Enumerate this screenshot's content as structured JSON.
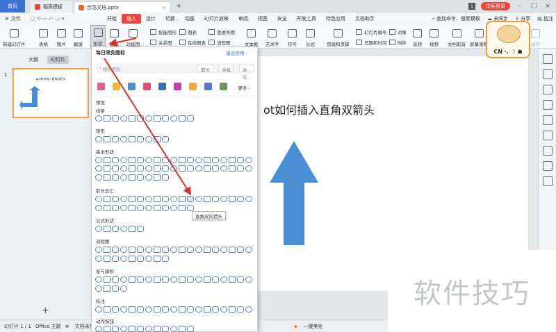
{
  "tabs": {
    "home": "首页",
    "template": "稻壳模板",
    "doc": "示范文档.pptx",
    "login_btn": "访客登录",
    "tab_badge": "1"
  },
  "menu": {
    "file": "文件",
    "items": [
      "开始",
      "插入",
      "设计",
      "切换",
      "动画",
      "幻灯片放映",
      "审阅",
      "视图",
      "安全",
      "开发工具",
      "特色应用",
      "文档助手"
    ],
    "active": "插入",
    "search": "查找命令、搜索模板",
    "sync": "未同步",
    "share": "分享",
    "comment": "批注"
  },
  "ribbon": {
    "new_slide": "新建幻灯片",
    "table": "表格",
    "image": "图片",
    "screenshot": "截屏",
    "shape": "形状",
    "icon": "图标",
    "function": "功能图",
    "smart": "智能图形",
    "chart": "图表",
    "mindmap": "思维导图",
    "relation": "关系图",
    "online_chart": "在线图表",
    "flowchart": "流程图",
    "textbox": "文本框",
    "art": "艺术字",
    "symbol": "符号",
    "formula": "公式",
    "header": "页眉和页脚",
    "slide_no": "幻灯片编号",
    "date": "日期和时间",
    "object": "对象",
    "attach": "附件",
    "audio": "音频",
    "video": "视频",
    "doc_dub": "文档配音",
    "record": "屏幕录制",
    "action": "动作"
  },
  "leftpanel": {
    "outline": "大纲",
    "slides": "幻灯片",
    "num": "1",
    "thumb_title": "ppt如何插入直角双箭头",
    "add": "+"
  },
  "slide": {
    "title_visible": "ot如何插入直角双箭头"
  },
  "dropdown": {
    "head": "每日限免图标",
    "recent": "最近使用",
    "search_ph": "搜索图标",
    "cat1": "箭头",
    "cat2": "手机",
    "cat3": "办公",
    "more": "更多",
    "preset": "预设",
    "line": "线条",
    "rect": "矩形",
    "basic": "基本形状",
    "arrow": "箭头总汇",
    "formula": "公式形状",
    "flow": "流程图",
    "star": "星与旗帜",
    "callout": "标注",
    "action": "动作按钮"
  },
  "tooltip": "直角双向箭头",
  "status": {
    "slide": "幻灯片 1 / 1",
    "theme": "Office 主题",
    "protect": "文档未保护",
    "beautify": "一键美化"
  },
  "watermark": "软件技巧",
  "mascot": {
    "label": "CN ·, ☽ ☗"
  },
  "colors": {
    "accent": "#e8483f",
    "arrow_fill": "#4a8fd4",
    "annotation": "#d9302a"
  }
}
